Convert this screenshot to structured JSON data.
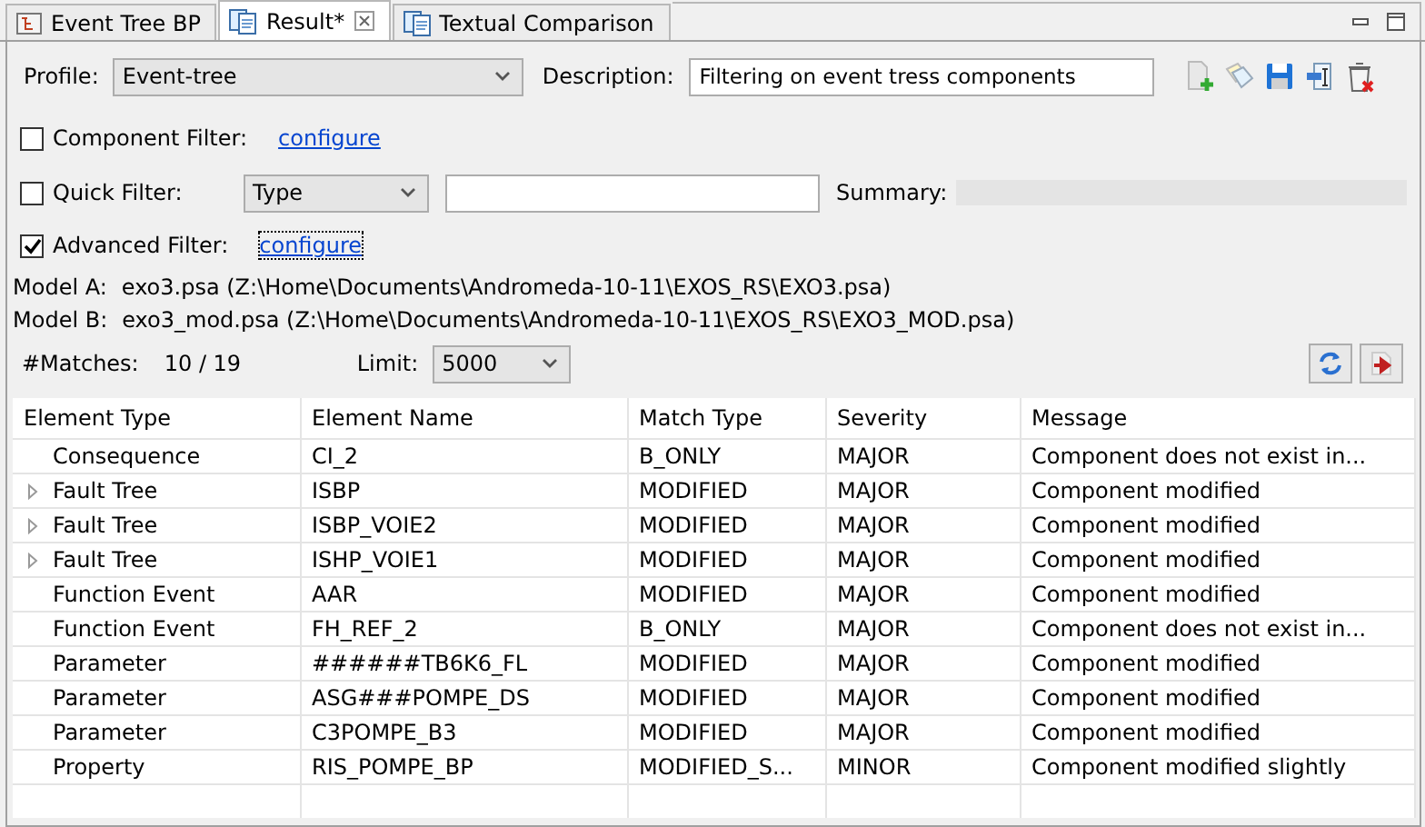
{
  "tabs": [
    {
      "label": "Event Tree BP",
      "selected": false,
      "closable": false
    },
    {
      "label": "Result*",
      "selected": true,
      "closable": true
    },
    {
      "label": "Textual Comparison",
      "selected": false,
      "closable": false
    }
  ],
  "profile": {
    "label": "Profile:",
    "value": "Event-tree"
  },
  "description": {
    "label": "Description:",
    "value": "Filtering on event tress components"
  },
  "component_filter": {
    "label": "Component Filter:",
    "checked": false,
    "link": "configure"
  },
  "quick_filter": {
    "label": "Quick Filter:",
    "checked": false,
    "type": "Type",
    "summary_label": "Summary:"
  },
  "advanced_filter": {
    "label": "Advanced Filter:",
    "checked": true,
    "link": "configure"
  },
  "models": [
    {
      "label": "Model A:",
      "value": "exo3.psa (Z:\\Home\\Documents\\Andromeda-10-11\\EXOS_RS\\EXO3.psa)"
    },
    {
      "label": "Model B:",
      "value": "exo3_mod.psa (Z:\\Home\\Documents\\Andromeda-10-11\\EXOS_RS\\EXO3_MOD.psa)"
    }
  ],
  "matches": {
    "label": "#Matches:",
    "value": "10 / 19"
  },
  "limit": {
    "label": "Limit:",
    "value": "5000"
  },
  "table": {
    "columns": [
      "Element Type",
      "Element Name",
      "Match Type",
      "Severity",
      "Message"
    ],
    "rows": [
      {
        "expandable": false,
        "cells": [
          "Consequence",
          "CI_2",
          "B_ONLY",
          "MAJOR",
          "Component does not exist in..."
        ]
      },
      {
        "expandable": true,
        "cells": [
          "Fault Tree",
          "ISBP",
          "MODIFIED",
          "MAJOR",
          "Component modified"
        ]
      },
      {
        "expandable": true,
        "cells": [
          "Fault Tree",
          "ISBP_VOIE2",
          "MODIFIED",
          "MAJOR",
          "Component modified"
        ]
      },
      {
        "expandable": true,
        "cells": [
          "Fault Tree",
          "ISHP_VOIE1",
          "MODIFIED",
          "MAJOR",
          "Component modified"
        ]
      },
      {
        "expandable": false,
        "cells": [
          "Function Event",
          "AAR",
          "MODIFIED",
          "MAJOR",
          "Component modified"
        ]
      },
      {
        "expandable": false,
        "cells": [
          "Function Event",
          "FH_REF_2",
          "B_ONLY",
          "MAJOR",
          "Component does not exist in..."
        ]
      },
      {
        "expandable": false,
        "cells": [
          "Parameter",
          "######TB6K6_FL",
          "MODIFIED",
          "MAJOR",
          "Component modified"
        ]
      },
      {
        "expandable": false,
        "cells": [
          "Parameter",
          "ASG###POMPE_DS",
          "MODIFIED",
          "MAJOR",
          "Component modified"
        ]
      },
      {
        "expandable": false,
        "cells": [
          "Parameter",
          "C3POMPE_B3",
          "MODIFIED",
          "MAJOR",
          "Component modified"
        ]
      },
      {
        "expandable": false,
        "cells": [
          "Property",
          "RIS_POMPE_BP",
          "MODIFIED_S...",
          "MINOR",
          "Component modified slightly"
        ]
      }
    ]
  }
}
